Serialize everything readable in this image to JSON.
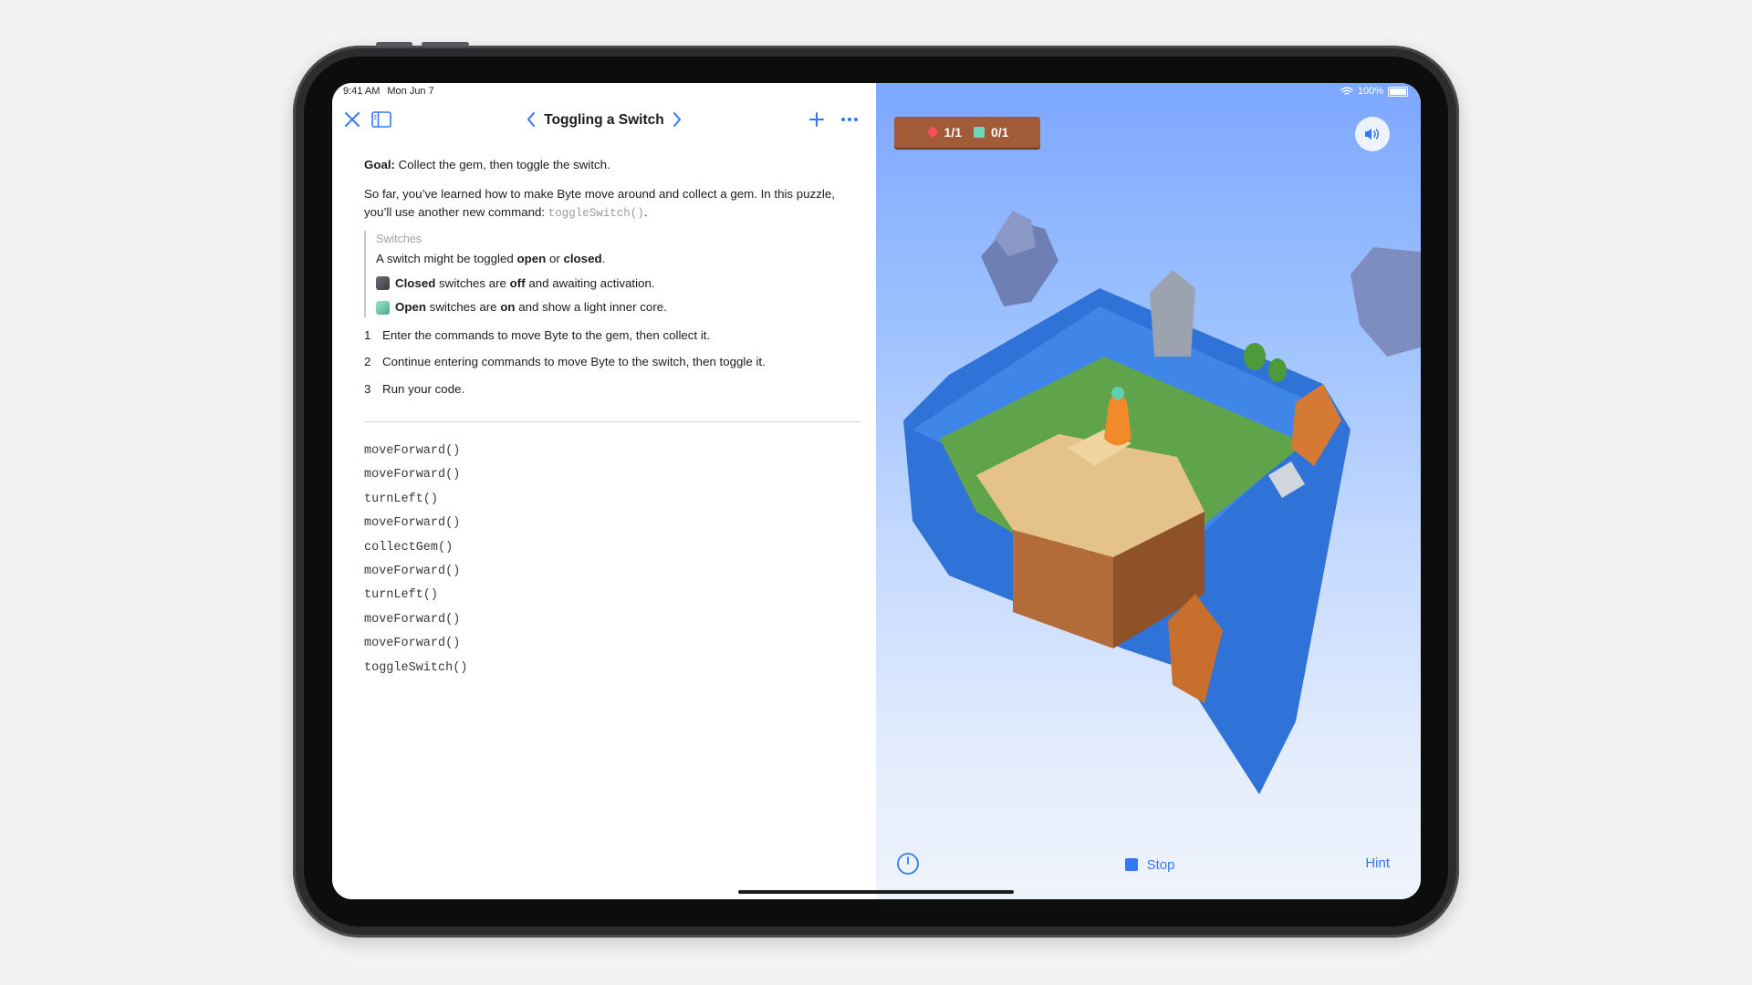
{
  "status": {
    "time": "9:41 AM",
    "date": "Mon Jun 7",
    "wifi_icon": "wifi-icon",
    "battery": "100%"
  },
  "nav": {
    "title": "Toggling a Switch",
    "icons": [
      "close-icon",
      "sidebar-icon",
      "chevron-left-icon",
      "chevron-right-icon",
      "plus-icon",
      "more-icon"
    ]
  },
  "content": {
    "goal_label": "Goal:",
    "goal_text": " Collect the gem, then toggle the switch.",
    "intro_text": "So far, you’ve learned how to make Byte move around and collect a gem. In this puzzle, you’ll use another new command: ",
    "intro_code": "toggleSwitch()",
    "intro_end": ".",
    "callout": {
      "title": "Switches",
      "line1_a": "A switch might be toggled ",
      "line1_b": "open",
      "line1_c": " or ",
      "line1_d": "closed",
      "line1_e": ".",
      "closed_a": "Closed",
      "closed_b": " switches are ",
      "closed_c": "off",
      "closed_d": " and awaiting activation.",
      "open_a": "Open",
      "open_b": " switches are ",
      "open_c": "on",
      "open_d": " and show a light inner core."
    },
    "steps": [
      {
        "num": "1",
        "text": "Enter the commands to move Byte to the gem, then collect it."
      },
      {
        "num": "2",
        "text": "Continue entering commands to move Byte to the switch, then toggle it."
      },
      {
        "num": "3",
        "text": "Run your code."
      }
    ]
  },
  "code_lines": [
    "moveForward()",
    "moveForward()",
    "turnLeft()",
    "moveForward()",
    "collectGem()",
    "moveForward()",
    "turnLeft()",
    "moveForward()",
    "moveForward()",
    "toggleSwitch()"
  ],
  "game": {
    "gems": "1/1",
    "switches": "0/1",
    "stop_label": "Stop",
    "hint_label": "Hint",
    "colors": {
      "accent": "#3478f6",
      "board": "#a25b39",
      "sky_top": "#7da7ff"
    }
  }
}
